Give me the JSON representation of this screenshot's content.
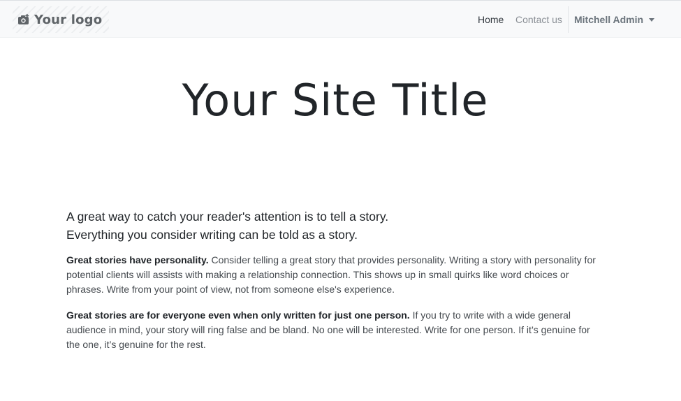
{
  "header": {
    "logo_text": "Your logo",
    "nav": {
      "home": "Home",
      "contact": "Contact us",
      "user": "Mitchell Admin"
    }
  },
  "hero": {
    "title": "Your Site Title"
  },
  "content": {
    "lead_line1": "A great way to catch your reader's attention is to tell a story.",
    "lead_line2": "Everything you consider writing can be told as a story.",
    "p1_bold": "Great stories have personality.",
    "p1_text": " Consider telling a great story that provides personality. Writing a story with personality for potential clients will assists with making a relationship connection. This shows up in small quirks like word choices or phrases. Write from your point of view, not from someone else's experience.",
    "p2_bold": "Great stories are for everyone even when only written for just one person.",
    "p2_text": " If you try to write with a wide general audience in mind, your story will ring false and be bland. No one will be interested. Write for one person. If it’s genuine for the one, it’s genuine for the rest."
  },
  "icons": {
    "logo": "camera-plus-icon",
    "user_menu": "caret-down-icon"
  },
  "colors": {
    "navbar_bg": "#f8f9fa",
    "text": "#212529",
    "muted": "#6c757d"
  }
}
